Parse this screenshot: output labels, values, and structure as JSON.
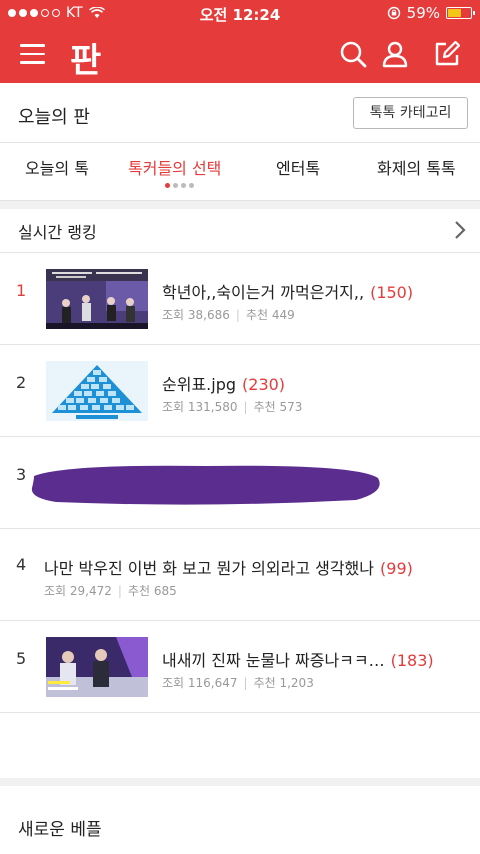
{
  "status_bar": {
    "carrier": "KT",
    "time": "오전 12:24",
    "battery": "59%",
    "battery_level": 0.59
  },
  "header": {
    "logo": "판",
    "icons": [
      "menu-icon",
      "search-icon",
      "user-icon",
      "edit-icon"
    ]
  },
  "page": {
    "title": "오늘의 판",
    "category_button": "톡톡 카테고리"
  },
  "tabs": [
    {
      "label": "오늘의 톡"
    },
    {
      "label": "톡커들의 선택"
    },
    {
      "label": "엔터톡"
    },
    {
      "label": "화제의 톡톡"
    }
  ],
  "ranking": {
    "title": "실시간 랭킹",
    "items": [
      {
        "rank": "1",
        "title": "학년아,,숙이는거 까먹은거지,,",
        "count": "(150)",
        "views": "조회 38,686",
        "recommends": "추천 449"
      },
      {
        "rank": "2",
        "title": "순위표.jpg",
        "count": "(230)",
        "views": "조회 131,580",
        "recommends": "추천 573"
      },
      {
        "rank": "3"
      },
      {
        "rank": "4",
        "title": "나만 박우진 이번 화 보고 뭔가 의외라고 생각했나",
        "count": "(99)",
        "views": "조회 29,472",
        "recommends": "추천 685"
      },
      {
        "rank": "5",
        "title": "내새끼 진짜 눈물나 짜증나ㅋㅋ…",
        "count": "(183)",
        "views": "조회 116,647",
        "recommends": "추천 1,203"
      }
    ]
  },
  "new_section": {
    "title": "새로운 베플"
  },
  "colors": {
    "brand": "#e53b3b",
    "scribble": "#5b2d8e"
  }
}
